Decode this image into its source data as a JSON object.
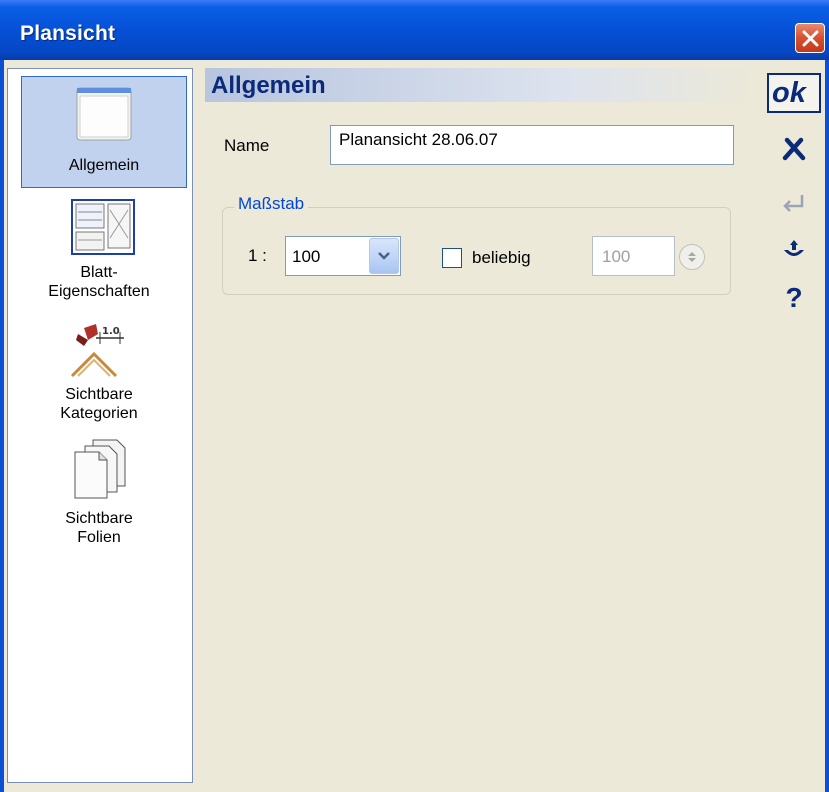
{
  "window": {
    "title": "Plansicht"
  },
  "sidebar": {
    "items": [
      {
        "label_lines": [
          "Allgemein"
        ]
      },
      {
        "label_lines": [
          "Blatt-",
          "Eigenschaften"
        ]
      },
      {
        "label_lines": [
          "Sichtbare",
          "Kategorien"
        ]
      },
      {
        "label_lines": [
          "Sichtbare",
          "Folien"
        ]
      }
    ]
  },
  "content": {
    "header": "Allgemein",
    "name_label": "Name",
    "name_value": "Planansicht 28.06.07",
    "scale_group_title": "Maßstab",
    "scale_prefix": "1 :",
    "scale_selected": "100",
    "custom_checkbox_label": "beliebig",
    "custom_checked": false,
    "custom_value": "100"
  },
  "toolbar": {
    "ok_label": "ok",
    "help_label": "?"
  },
  "colors": {
    "title_bar": "#0650d6",
    "accent": "#0b2a7a",
    "selection": "#c1d2ee",
    "background": "#ece9d8",
    "close_button": "#d8502f"
  }
}
